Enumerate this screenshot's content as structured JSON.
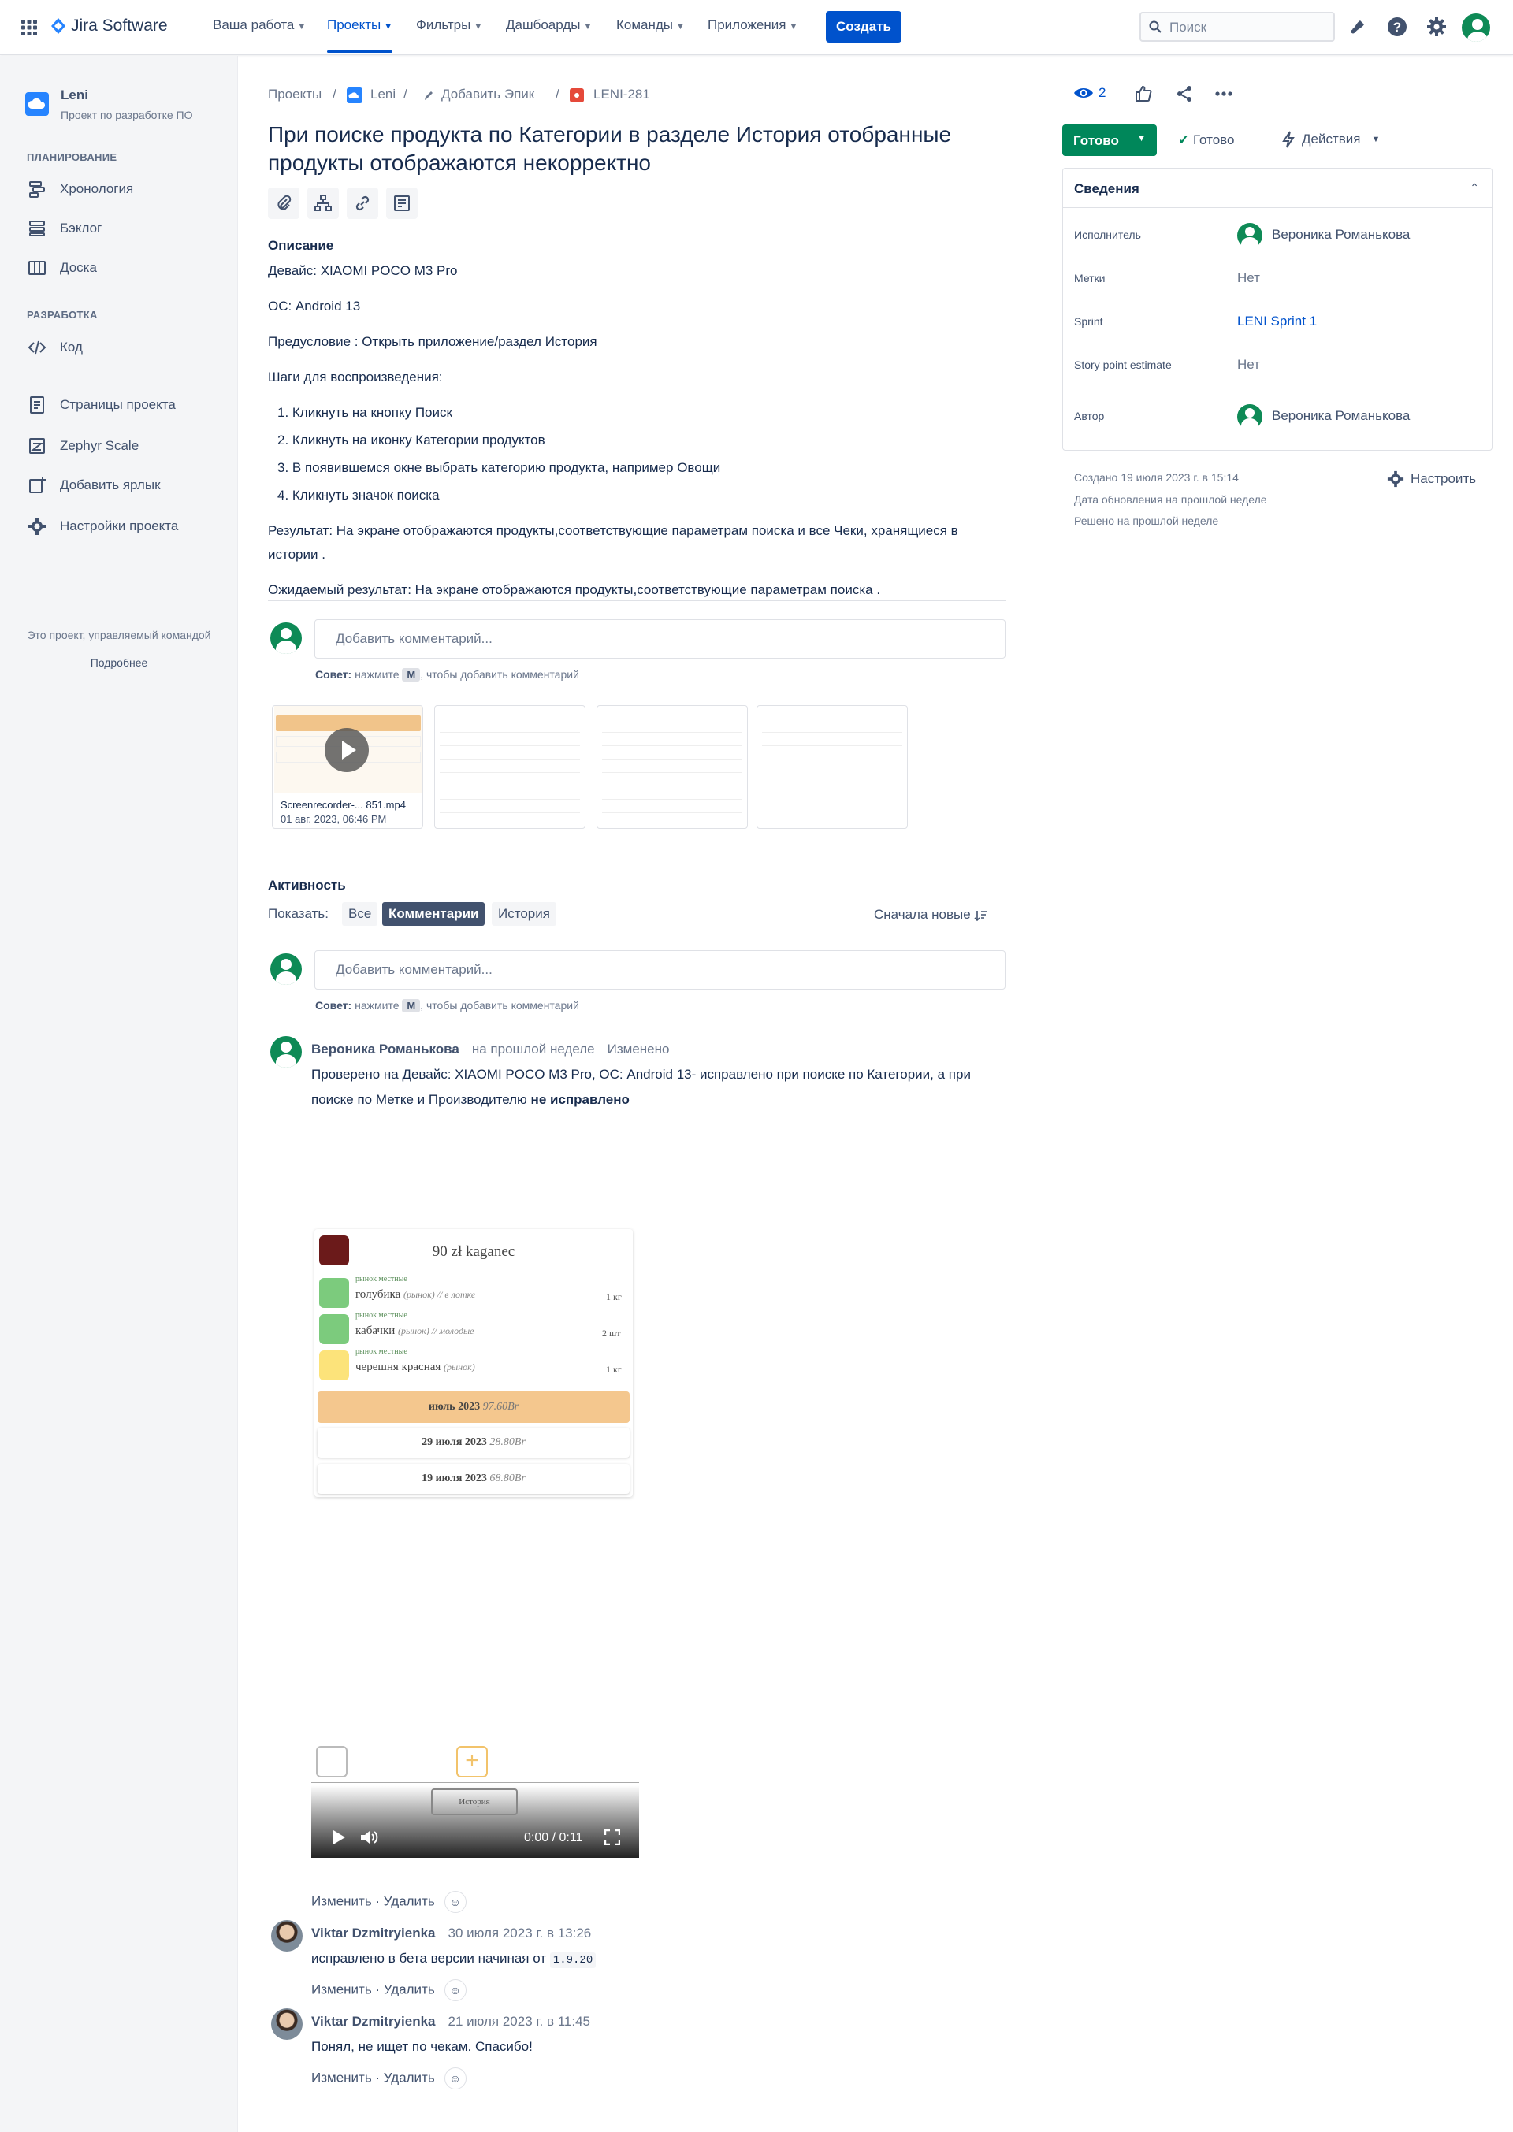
{
  "topnav": {
    "logo": "Jira Software",
    "items": [
      "Ваша работа",
      "Проекты",
      "Фильтры",
      "Дашбоарды",
      "Команды",
      "Приложения"
    ],
    "create": "Создать",
    "search_placeholder": "Поиск"
  },
  "sidebar": {
    "project_name": "Leni",
    "project_type": "Проект по разработке ПО",
    "planning_head": "ПЛАНИРОВАНИЕ",
    "planning": [
      "Хронология",
      "Бэклог",
      "Доска"
    ],
    "dev_head": "РАЗРАБОТКА",
    "dev": [
      "Код"
    ],
    "other": [
      "Страницы проекта",
      "Zephyr Scale",
      "Добавить ярлык",
      "Настройки проекта"
    ],
    "footer": "Это проект, управляемый командой",
    "more": "Подробнее"
  },
  "breadcrumb": [
    "Проекты",
    "Leni",
    "Добавить Эпик",
    "LENI-281"
  ],
  "issue": {
    "title_line1": "При поиске продукта по Категории в разделе История отобранные",
    "title_line2": "продукты отображаются некорректно",
    "description_head": "Описание",
    "desc": [
      "Девайс: XIAOMI POCO M3 Pro",
      "ОС: Android 13",
      "Предусловие : Открыть приложение/раздел История",
      "Шаги для воспроизведения:"
    ],
    "steps": [
      "1. Кликнуть на кнопку Поиск",
      "2. Кликнуть на иконку Категории продуктов",
      "3. В появившемся окне выбрать категорию продукта, например Овощи",
      "4. Кликнуть значок поиска"
    ],
    "result_1": "Результат: На экране отображаются продукты,соответствующие параметрам поиска и все Чеки, хранящиеся в",
    "result_2": "истории .",
    "expected": "Ожидаемый результат: На экране отображаются продукты,соответствующие параметрам поиска ."
  },
  "comment_box": {
    "placeholder": "Добавить комментарий...",
    "tip_label": "Совет:",
    "tip_pre": "нажмите",
    "tip_key": "M",
    "tip_post": ", чтобы добавить комментарий"
  },
  "attachment": {
    "filename": "Screenrecorder-... 851.mp4",
    "date": "01 авг. 2023, 06:46 PM"
  },
  "activity": {
    "head": "Активность",
    "show": "Показать:",
    "tabs": [
      "Все",
      "Комментарии",
      "История"
    ],
    "sort": "Сначала новые"
  },
  "comments": [
    {
      "author": "Вероника Романькова",
      "when": "на прошлой неделе",
      "edited": "Изменено",
      "line1": "Проверено на Девайс: XIAOMI POCO M3 Pro, ОС: Android 13- исправлено при поиске по Категории, а при",
      "line2": "поиске по Метке и Производителю",
      "line2_bold": "не исправлено"
    },
    {
      "author": "Viktar Dzmitryienka",
      "when": "30 июля 2023 г. в 13:26",
      "text": "исправлено в бета версии начиная от",
      "code": "1.9.20"
    },
    {
      "author": "Viktar Dzmitryienka",
      "when": "21 июля 2023 г. в 11:45",
      "text": "Понял, не ищет по чекам. Спасибо!"
    }
  ],
  "comment_actions": {
    "edit": "Изменить",
    "delete": "Удалить"
  },
  "video": {
    "store": "90 zł kaganec",
    "rows": [
      {
        "tags": "рынок  местные",
        "name": "голубика",
        "note": "(рынок) // в лотке",
        "qty": "1 кг"
      },
      {
        "tags": "рынок  местные",
        "name": "кабачки",
        "note": "(рынок) // молодые",
        "qty": "2 шт"
      },
      {
        "tags": "рынок  местные",
        "name": "черешня красная",
        "note": "(рынок)",
        "qty": "1 кг"
      }
    ],
    "month": "июль 2023",
    "month_sum": "97.60Br",
    "d1": "29 июля 2023",
    "d1_sum": "28.80Br",
    "d2": "19 июля 2023",
    "d2_sum": "68.80Br",
    "nav_label": "История",
    "time": "0:00 / 0:11"
  },
  "right": {
    "watchers": "2",
    "status": "Готово",
    "done": "Готово",
    "actions": "Действия",
    "details_head": "Сведения",
    "fields": [
      {
        "label": "Исполнитель",
        "value": "Вероника Романькова"
      },
      {
        "label": "Метки",
        "value": "Нет"
      },
      {
        "label": "Sprint",
        "value": "LENI Sprint 1"
      },
      {
        "label": "Story point estimate",
        "value": "Нет"
      },
      {
        "label": "Автор",
        "value": "Вероника Романькова"
      }
    ],
    "created": "Создано 19 июля 2023 г. в 15:14",
    "updated": "Дата обновления на прошлой неделе",
    "resolved": "Решено на прошлой неделе",
    "configure": "Настроить"
  },
  "colors": {
    "brand": "#0052cc",
    "done_green": "#00875a",
    "avatar_green": "#0e8a56"
  }
}
